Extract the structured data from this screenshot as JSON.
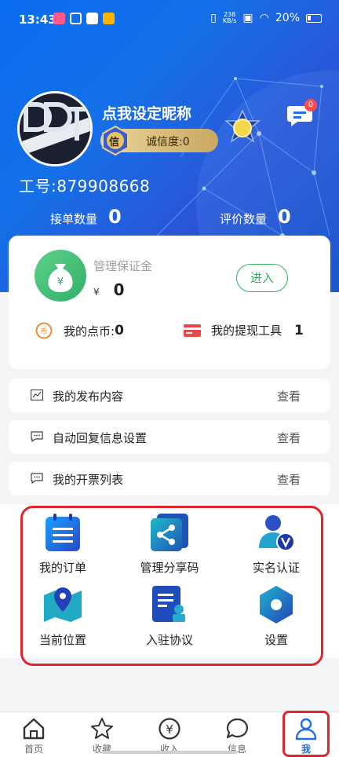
{
  "status_bar": {
    "time": "13:43",
    "net_speed": "238\nKB/s",
    "battery": "20%"
  },
  "profile": {
    "nickname": "点我设定昵称",
    "credit_badge": "信",
    "credit_label": "诚信度:0",
    "message_count": "0",
    "work_id": "工号:879908668",
    "orders_label": "接单数量",
    "orders_value": "0",
    "reviews_label": "评价数量",
    "reviews_value": "0"
  },
  "bond": {
    "title": "管理保证金",
    "currency": "¥",
    "amount": "0",
    "enter_label": "进入"
  },
  "wallet": {
    "coins_label": "我的点币:",
    "coins_value": "0",
    "tools_label": "我的提现工具",
    "tools_value": "1"
  },
  "list": [
    {
      "label": "我的发布内容",
      "action": "查看"
    },
    {
      "label": "自动回复信息设置",
      "action": "查看"
    },
    {
      "label": "我的开票列表",
      "action": "查看"
    }
  ],
  "grid": [
    {
      "label": "我的订单",
      "icon": "orders-icon"
    },
    {
      "label": "管理分享码",
      "icon": "share-code-icon"
    },
    {
      "label": "实名认证",
      "icon": "verify-icon"
    },
    {
      "label": "当前位置",
      "icon": "location-icon"
    },
    {
      "label": "入驻协议",
      "icon": "agreement-icon"
    },
    {
      "label": "设置",
      "icon": "settings-icon"
    }
  ],
  "tabs": [
    {
      "label": "首页",
      "icon": "home-icon"
    },
    {
      "label": "收藏",
      "icon": "star-icon"
    },
    {
      "label": "收入",
      "icon": "yuan-icon"
    },
    {
      "label": "信息",
      "icon": "chat-icon"
    },
    {
      "label": "我",
      "icon": "user-icon",
      "active": true
    }
  ],
  "colors": {
    "brand_blue": "#1f6fe8",
    "green": "#34b065",
    "highlight_red": "#e0252f"
  }
}
